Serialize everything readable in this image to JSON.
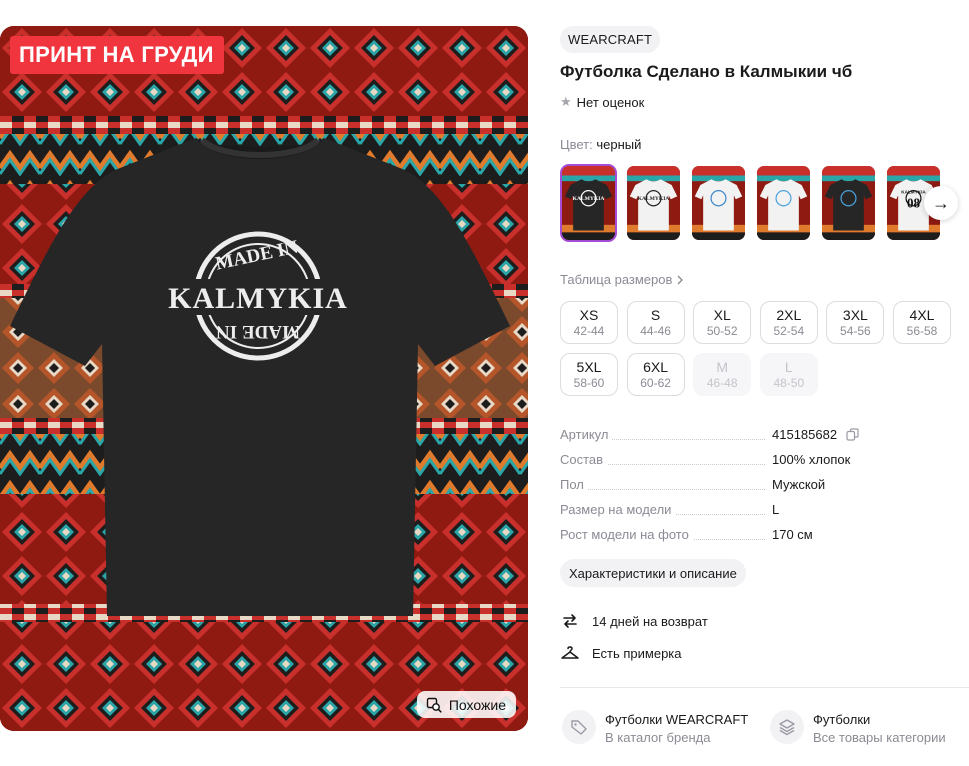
{
  "image": {
    "badge": "ПРИНТ НА ГРУДИ",
    "print_line1": "MADE IN",
    "print_main": "KALMYKIA",
    "print_line2": "MADE IN",
    "similar_label": "Похожие",
    "shirt_color": "#262626",
    "pattern_colors": [
      "#8e1a12",
      "#c9302c",
      "#2aa6a8",
      "#e07a2c",
      "#1d1d1d",
      "#e8d9c6",
      "#b5562a"
    ]
  },
  "product": {
    "brand": "WEARCRAFT",
    "title": "Футболка Сделано в Калмыкии чб",
    "rating_text": "Нет оценок",
    "color_label": "Цвет:",
    "color_value": "черный",
    "accent_color": "#a54cd6",
    "swatches": [
      {
        "shirt": "#262626",
        "print": "#ffffff",
        "text": "KALMYKIA",
        "selected": true
      },
      {
        "shirt": "#f2f2f2",
        "print": "#222222",
        "text": "KALMYKIA",
        "selected": false
      },
      {
        "shirt": "#f2f2f2",
        "print": "#3c87c8",
        "text": "",
        "selected": false
      },
      {
        "shirt": "#f2f2f2",
        "print": "#4aa3df",
        "text": "",
        "selected": false
      },
      {
        "shirt": "#262626",
        "print": "#4aa3df",
        "text": "",
        "selected": false
      },
      {
        "shirt": "#f2f2f2",
        "print": "#111111",
        "text": "08",
        "caption": "KALMYKIA",
        "selected": false
      }
    ]
  },
  "sizes": {
    "table_link": "Таблица размеров",
    "items": [
      {
        "size": "XS",
        "ru": "42-44",
        "available": true
      },
      {
        "size": "S",
        "ru": "44-46",
        "available": true
      },
      {
        "size": "XL",
        "ru": "50-52",
        "available": true
      },
      {
        "size": "2XL",
        "ru": "52-54",
        "available": true
      },
      {
        "size": "3XL",
        "ru": "54-56",
        "available": true
      },
      {
        "size": "4XL",
        "ru": "56-58",
        "available": true
      },
      {
        "size": "5XL",
        "ru": "58-60",
        "available": true
      },
      {
        "size": "6XL",
        "ru": "60-62",
        "available": true
      },
      {
        "size": "M",
        "ru": "46-48",
        "available": false
      },
      {
        "size": "L",
        "ru": "48-50",
        "available": false
      }
    ]
  },
  "specs": [
    {
      "key": "Артикул",
      "value": "415185682"
    },
    {
      "key": "Состав",
      "value": "100% хлопок"
    },
    {
      "key": "Пол",
      "value": "Мужской"
    },
    {
      "key": "Размер на модели",
      "value": "L"
    },
    {
      "key": "Рост модели на фото",
      "value": "170 см"
    }
  ],
  "characteristics_button": "Характеристики и описание",
  "features": {
    "return": "14 дней на возврат",
    "fitting": "Есть примерка"
  },
  "categories": [
    {
      "title": "Футболки WEARCRAFT",
      "subtitle": "В каталог бренда",
      "icon": "tag-icon"
    },
    {
      "title": "Футболки",
      "subtitle": "Все товары категории",
      "icon": "stack-icon"
    }
  ]
}
